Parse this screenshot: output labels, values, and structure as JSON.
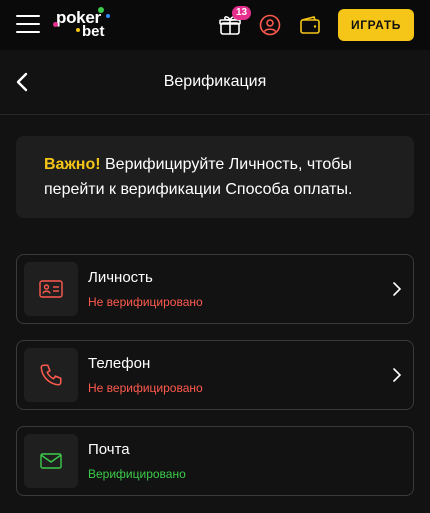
{
  "topbar": {
    "logo_line1": "poker",
    "logo_line2": "bet",
    "gift_count": "13",
    "play_label": "ИГРАТЬ"
  },
  "page": {
    "title": "Верификация"
  },
  "notice": {
    "strong": "Важно!",
    "text": " Верифицируйте Личность, чтобы перейти к верификации Способа оплаты."
  },
  "items": [
    {
      "label": "Личность",
      "status": "Не верифицировано",
      "icon": "id-card-icon",
      "verified": false
    },
    {
      "label": "Телефон",
      "status": "Не верифицировано",
      "icon": "phone-icon",
      "verified": false
    },
    {
      "label": "Почта",
      "status": "Верифицировано",
      "icon": "mail-icon",
      "verified": true
    }
  ],
  "colors": {
    "accent": "#f5c518",
    "badge": "#e62e8c",
    "unverified": "#ff5a4e",
    "verified": "#3ccc4a",
    "background": "#121212"
  }
}
